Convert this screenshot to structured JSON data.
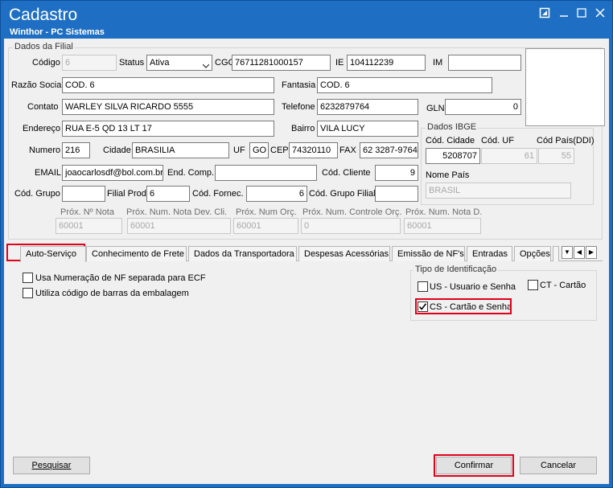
{
  "window": {
    "title": "Cadastro",
    "subtitle": "Winthor - PC Sistemas",
    "icons": [
      "restore-icon",
      "minimize-icon",
      "maximize-icon",
      "close-icon"
    ]
  },
  "filial": {
    "group_label": "Dados da Filial",
    "codigo_label": "Código",
    "codigo": "6",
    "status_label": "Status",
    "status": "Ativa",
    "cgc_label": "CGC",
    "cgc": "76711281000157",
    "ie_label": "IE",
    "ie": "104112239",
    "im_label": "IM",
    "im": "",
    "razao_label": "Razão Social",
    "razao": "COD. 6",
    "fantasia_label": "Fantasia",
    "fantasia": "COD. 6",
    "contato_label": "Contato",
    "contato": "WARLEY SILVA RICARDO 5555",
    "telefone_label": "Telefone",
    "telefone": "6232879764",
    "gln_label": "GLN",
    "gln": "0",
    "endereco_label": "Endereço",
    "endereco": "RUA E-5 QD 13 LT 17",
    "bairro_label": "Bairro",
    "bairro": "VILA LUCY",
    "numero_label": "Numero",
    "numero": "216",
    "cidade_label": "Cidade",
    "cidade": "BRASILIA",
    "uf_label": "UF",
    "uf": "GO",
    "cep_label": "CEP",
    "cep": "74320110",
    "fax_label": "FAX",
    "fax": "62 3287-9764",
    "email_label": "EMAIL",
    "email": "joaocarlosdf@bol.com.br",
    "endcomp_label": "End. Comp.",
    "endcomp": "",
    "codcliente_label": "Cód. Cliente",
    "codcliente": "9",
    "codgrupo_label": "Cód. Grupo",
    "codgrupo": "",
    "filialprod_label": "Filial Prod.",
    "filialprod": "6",
    "codfornec_label": "Cód. Fornec.",
    "codfornec": "6",
    "codgrupofilial_label": "Cód. Grupo Filial",
    "codgrupofilial": ""
  },
  "ibge": {
    "group_label": "Dados IBGE",
    "codcidade_label": "Cód. Cidade",
    "codcidade": "5208707",
    "coduf_label": "Cód. UF",
    "coduf": "61",
    "codpais_label": "Cód País(DDI)",
    "codpais": "55",
    "nomepais_label": "Nome País",
    "nomepais": "BRASIL"
  },
  "proximos": {
    "nota_label": "Próx. Nº Nota",
    "nota": "60001",
    "devcli_label": "Próx. Num. Nota Dev. Cli.",
    "devcli": "60001",
    "orc_label": "Próx. Num Orç.",
    "orc": "60001",
    "controle_label": "Próx. Num. Controle Orç.",
    "controle": "0",
    "notad_label": "Próx. Num. Nota D.",
    "notad": "60001"
  },
  "tabs": [
    "Auto-Serviço",
    "Conhecimento de Frete",
    "Dados da Transportadora",
    "Despesas Acessórias",
    "Emissão de NF's",
    "Entradas",
    "Opções"
  ],
  "autoservico": {
    "cb1_label": "Usa Numeração de NF separada para ECF",
    "cb1_checked": false,
    "cb2_label": "Utiliza código de barras da embalagem",
    "cb2_checked": false,
    "tipo_label": "Tipo de Identificação",
    "us_label": "US - Usuario e Senha",
    "us_checked": false,
    "ct_label": "CT - Cartão",
    "ct_checked": false,
    "cs_label": "CS - Cartão e Senha",
    "cs_checked": true
  },
  "buttons": {
    "pesquisar": "Pesquisar",
    "confirmar": "Confirmar",
    "cancelar": "Cancelar"
  },
  "colors": {
    "titlebar": "#1e6fc4",
    "highlight": "#e0001a",
    "client": "#f0f0f0"
  }
}
